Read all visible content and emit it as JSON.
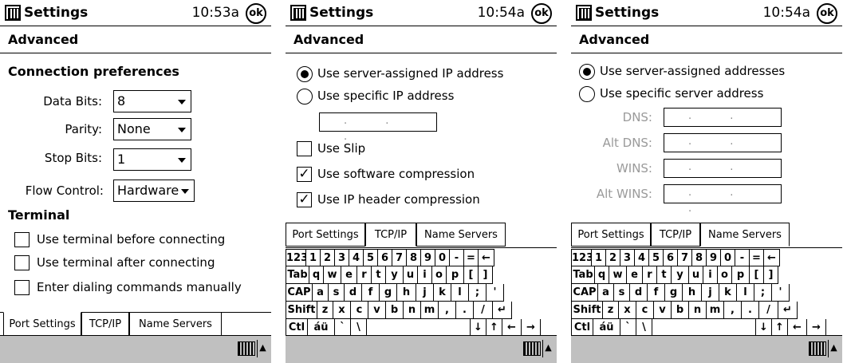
{
  "screens": [
    {
      "title": "Settings",
      "time": "10:53a",
      "ok": "ok",
      "heading": "Advanced",
      "connection_header": "Connection preferences",
      "fields": [
        {
          "label": "Data Bits:",
          "value": "8"
        },
        {
          "label": "Parity:",
          "value": "None"
        },
        {
          "label": "Stop Bits:",
          "value": "1"
        },
        {
          "label": "Flow Control:",
          "value": "Hardware"
        }
      ],
      "terminal_header": "Terminal",
      "checks": [
        {
          "label": "Use terminal before connecting",
          "checked": false
        },
        {
          "label": "Use terminal after connecting",
          "checked": false
        },
        {
          "label": "Enter dialing commands manually",
          "checked": false
        }
      ],
      "tabs": [
        "Port Settings",
        "TCP/IP",
        "Name Servers"
      ],
      "active_tab": "Port Settings"
    },
    {
      "title": "Settings",
      "time": "10:54a",
      "ok": "ok",
      "heading": "Advanced",
      "radios": [
        {
          "label": "Use server-assigned IP address",
          "selected": true
        },
        {
          "label": "Use specific IP address",
          "selected": false
        }
      ],
      "ip_value": ". . .",
      "checks": [
        {
          "label": "Use Slip",
          "checked": false
        },
        {
          "label": "Use software compression",
          "checked": true
        },
        {
          "label": "Use IP header compression",
          "checked": true
        }
      ],
      "tabs": [
        "Port Settings",
        "TCP/IP",
        "Name Servers"
      ],
      "active_tab": "TCP/IP"
    },
    {
      "title": "Settings",
      "time": "10:54a",
      "ok": "ok",
      "heading": "Advanced",
      "radios": [
        {
          "label": "Use server-assigned addresses",
          "selected": true
        },
        {
          "label": "Use specific server address",
          "selected": false
        }
      ],
      "servers": [
        {
          "label": "DNS:",
          "value": ". . ."
        },
        {
          "label": "Alt DNS:",
          "value": ". . ."
        },
        {
          "label": "WINS:",
          "value": ". . ."
        },
        {
          "label": "Alt WINS:",
          "value": ". . ."
        }
      ],
      "tabs": [
        "Port Settings",
        "TCP/IP",
        "Name Servers"
      ],
      "active_tab": "Name Servers"
    }
  ],
  "keyboard": {
    "row1": [
      "123",
      "1",
      "2",
      "3",
      "4",
      "5",
      "6",
      "7",
      "8",
      "9",
      "0",
      "-",
      "=",
      "←"
    ],
    "row2": [
      "Tab",
      "q",
      "w",
      "e",
      "r",
      "t",
      "y",
      "u",
      "i",
      "o",
      "p",
      "[",
      "]"
    ],
    "row3": [
      "CAP",
      "a",
      "s",
      "d",
      "f",
      "g",
      "h",
      "j",
      "k",
      "l",
      ";",
      "'"
    ],
    "row4": [
      "Shift",
      "z",
      "x",
      "c",
      "v",
      "b",
      "n",
      "m",
      ",",
      ".",
      "/",
      "↵"
    ],
    "row5": [
      "Ctl",
      "áü",
      "`",
      "\\",
      "",
      "↓",
      "↑",
      "←",
      "→"
    ]
  },
  "status": {
    "keyboard_icon": "keyboard-icon",
    "arrow": "▲"
  },
  "colors": {
    "statusbar": "#c0c0c0",
    "disabled_text": "#9a9a9a"
  }
}
